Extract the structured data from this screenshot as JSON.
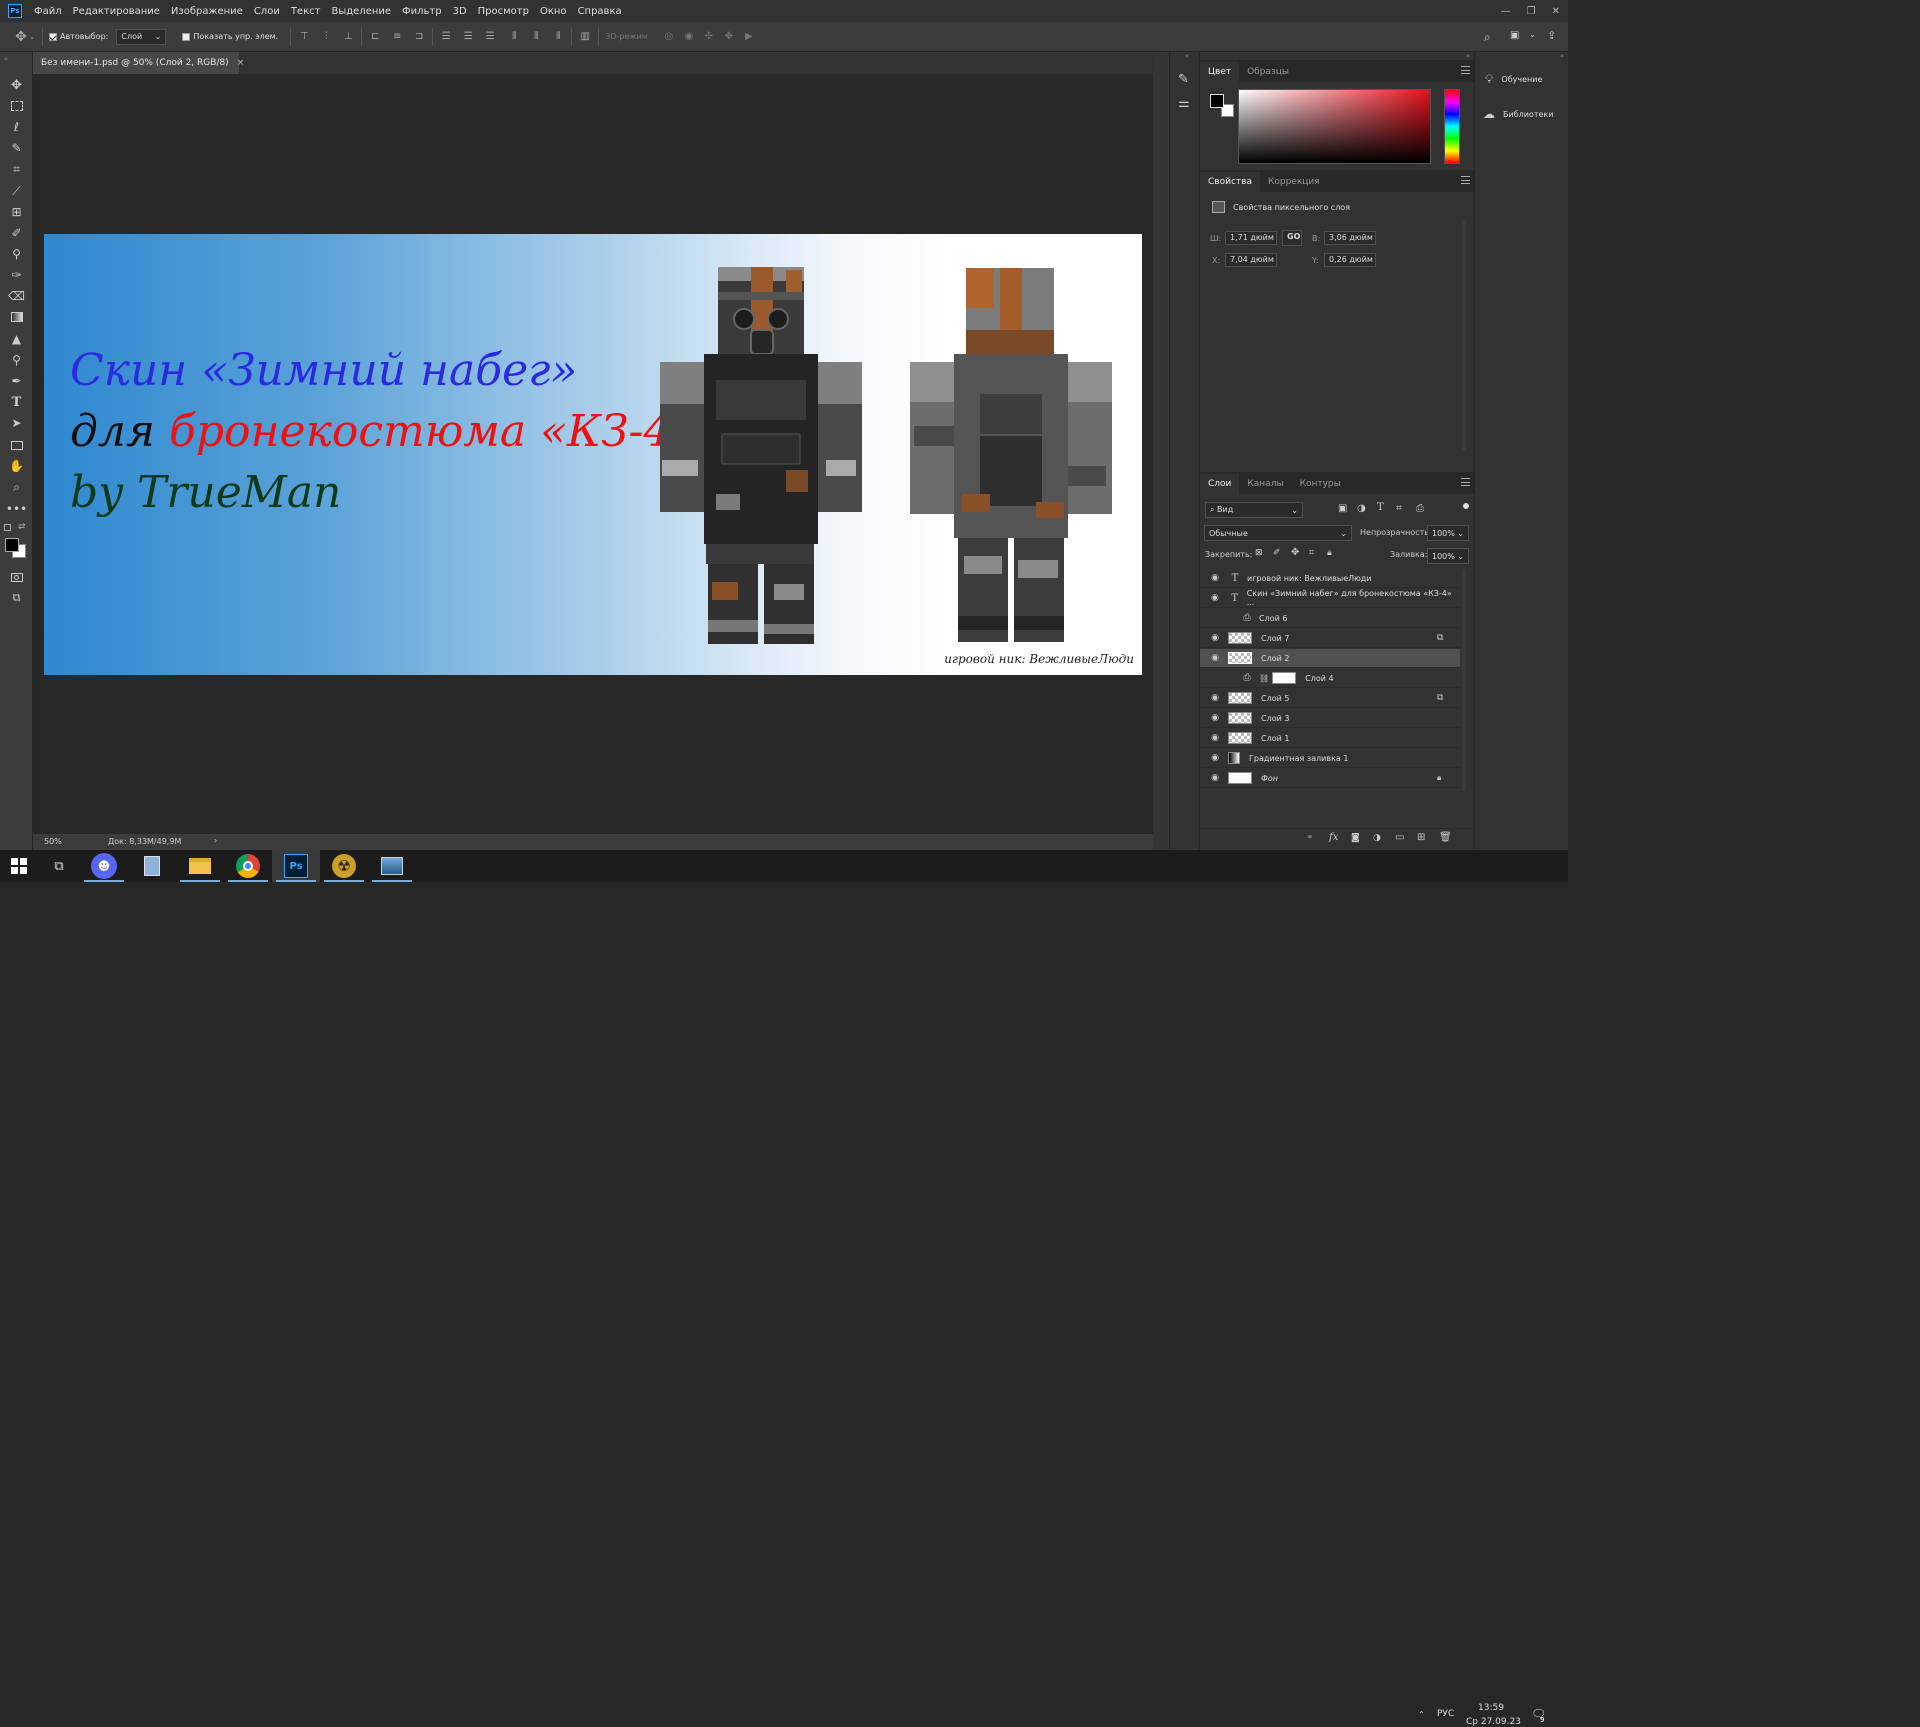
{
  "app": {
    "logo": "Ps"
  },
  "menu": [
    "Файл",
    "Редактирование",
    "Изображение",
    "Слои",
    "Текст",
    "Выделение",
    "Фильтр",
    "3D",
    "Просмотр",
    "Окно",
    "Справка"
  ],
  "options": {
    "autoselect_label": "Автовыбор:",
    "autoselect_value": "Слой",
    "show_transform_label": "Показать упр. элем.",
    "mode_3d": "3D-режим"
  },
  "document": {
    "tab_title": "Без имени-1.psd @ 50% (Слой 2, RGB/8)",
    "close": "×"
  },
  "canvas": {
    "line1": "Скин «Зимний набег»",
    "line2a": "для ",
    "line2b": "бронекостюма «КЗ-4»",
    "line3": "by TrueMan",
    "nick": "игровой ник: ВежливыеЛюди",
    "colors": {
      "line1": "#2a2ae0",
      "line2a": "#0e0e0e",
      "line2b": "#ee1111",
      "line3": "#0d3a1a"
    }
  },
  "status": {
    "zoom": "50%",
    "doc_info": "Док: 8,33M/49,9M",
    "arrow": "›"
  },
  "color_panel": {
    "tab1": "Цвет",
    "tab2": "Образцы"
  },
  "properties_panel": {
    "tab1": "Свойства",
    "tab2": "Коррекция",
    "title": "Свойства пиксельного слоя",
    "w_label": "Ш:",
    "w": "1,71 дюйм",
    "h_label": "В:",
    "h": "3,06 дюйм",
    "x_label": "X:",
    "x": "7,04 дюйм",
    "y_label": "Y:",
    "y": "0,26 дюйм",
    "link": "GO"
  },
  "layers_panel": {
    "tab1": "Слои",
    "tab2": "Каналы",
    "tab3": "Контуры",
    "filter": "Вид",
    "blend": "Обычные",
    "opacity_label": "Непрозрачность:",
    "opacity": "100%",
    "lock_label": "Закрепить:",
    "fill_label": "Заливка:",
    "fill": "100%",
    "layers": [
      {
        "name": "игровой ник: ВежливыеЛюди",
        "type": "text",
        "visible": true,
        "selected": false
      },
      {
        "name": "Скин «Зимний набег» для бронекостюма «КЗ-4» ...",
        "type": "text",
        "visible": true,
        "selected": false
      },
      {
        "name": "Слой 6",
        "type": "smart",
        "visible": false,
        "selected": false
      },
      {
        "name": "Слой 7",
        "type": "pixel",
        "visible": true,
        "selected": false
      },
      {
        "name": "Слой 2",
        "type": "pixel",
        "visible": true,
        "selected": true
      },
      {
        "name": "Слой 4",
        "type": "mask",
        "visible": false,
        "selected": false
      },
      {
        "name": "Слой 5",
        "type": "pixel",
        "visible": true,
        "selected": false
      },
      {
        "name": "Слой 3",
        "type": "pixel",
        "visible": true,
        "selected": false
      },
      {
        "name": "Слой 1",
        "type": "pixel",
        "visible": true,
        "selected": false
      },
      {
        "name": "Градиентная заливка 1",
        "type": "gradient",
        "visible": true,
        "selected": false
      },
      {
        "name": "Фон",
        "type": "background",
        "visible": true,
        "selected": false
      }
    ],
    "footer_fx": "fx"
  },
  "side_panels": {
    "learn": "Обучение",
    "libraries": "Библиотеки"
  },
  "taskbar": {
    "lang": "РУС",
    "time": "13:59",
    "date": "Ср 27.09.23",
    "notif": "9"
  }
}
